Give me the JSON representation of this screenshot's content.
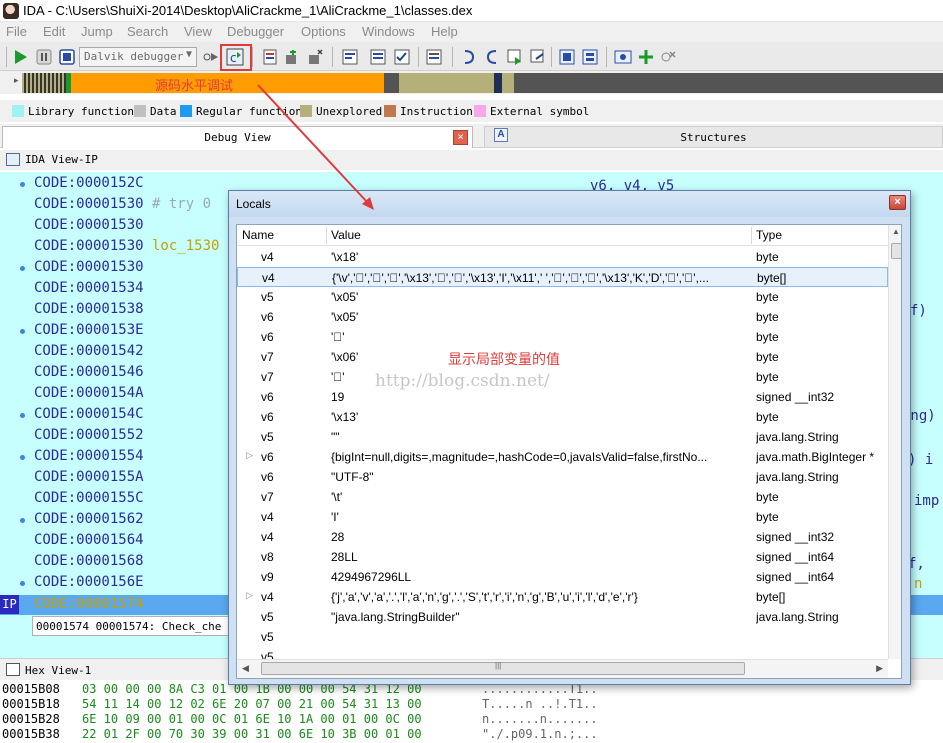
{
  "window": {
    "title": "IDA - C:\\Users\\ShuiXi-2014\\Desktop\\AliCrackme_1\\AliCrackme_1\\classes.dex"
  },
  "menu": [
    "File",
    "Edit",
    "Jump",
    "Search",
    "View",
    "Debugger",
    "Options",
    "Windows",
    "Help"
  ],
  "toolbar": {
    "debugger_select": "Dalvik debugger"
  },
  "legend": [
    {
      "label": "Library function",
      "color": "#9ff2f2"
    },
    {
      "label": "Data",
      "color": "#c0c0c0"
    },
    {
      "label": "Regular function",
      "color": "#1e9af0"
    },
    {
      "label": "Unexplored",
      "color": "#b5b07a"
    },
    {
      "label": "Instruction",
      "color": "#c07850"
    },
    {
      "label": "External symbol",
      "color": "#f7a8ea"
    }
  ],
  "tabs": {
    "debug_view": "Debug View",
    "structures": "Structures",
    "a_glyph": "A",
    "close_glyph": "×"
  },
  "ida_view": {
    "title": "IDA View-IP",
    "lines": [
      {
        "addr": "CODE:0000152C",
        "rest": ""
      },
      {
        "addr": "CODE:00001530",
        "rest": " # try 0"
      },
      {
        "addr": "CODE:00001530",
        "rest": ""
      },
      {
        "addr": "CODE:00001530",
        "rest": " loc_1530"
      },
      {
        "addr": "CODE:00001530",
        "rest": ""
      },
      {
        "addr": "CODE:00001534",
        "rest": ""
      },
      {
        "addr": "CODE:00001538",
        "rest": ""
      },
      {
        "addr": "CODE:0000153E",
        "rest": ""
      },
      {
        "addr": "CODE:00001542",
        "rest": ""
      },
      {
        "addr": "CODE:00001546",
        "rest": ""
      },
      {
        "addr": "CODE:0000154A",
        "rest": ""
      },
      {
        "addr": "CODE:0000154C",
        "rest": ""
      },
      {
        "addr": "CODE:00001552",
        "rest": ""
      },
      {
        "addr": "CODE:00001554",
        "rest": ""
      },
      {
        "addr": "CODE:0000155A",
        "rest": ""
      },
      {
        "addr": "CODE:0000155C",
        "rest": ""
      },
      {
        "addr": "CODE:00001562",
        "rest": ""
      },
      {
        "addr": "CODE:00001564",
        "rest": ""
      },
      {
        "addr": "CODE:00001568",
        "rest": ""
      },
      {
        "addr": "CODE:0000156E",
        "rest": ""
      }
    ],
    "ip_marker": "IP",
    "ip_line": "CODE:00001574",
    "status": "00001574 00001574: Check_che",
    "right_fragments": [
      "v6, v4, v5",
      "f)",
      "ing)",
      ") i",
      "imp",
      "f,",
      "n"
    ]
  },
  "locals": {
    "title": "Locals",
    "close_glyph": "×",
    "columns": {
      "name": "Name",
      "value": "Value",
      "type": "Type"
    },
    "rows": [
      {
        "name": "v4",
        "value": "'\\x18'",
        "type": "byte",
        "expandable": false
      },
      {
        "name": "v4",
        "value": "{'\\v','\u0000','\u0000','\u0000','\\x13','\u0000','\u0000','\\x13','I','\\x11',' ','\u0000','\u0000','\u0000','\\x13','K','D','\u0000','\u0000',...",
        "type": "byte[]",
        "expandable": false,
        "selected": true
      },
      {
        "name": "v5",
        "value": "'\\x05'",
        "type": "byte",
        "expandable": false
      },
      {
        "name": "v6",
        "value": "'\\x05'",
        "type": "byte",
        "expandable": false
      },
      {
        "name": "v6",
        "value": "'\u0000'",
        "type": "byte",
        "expandable": false
      },
      {
        "name": "v7",
        "value": "'\\x06'",
        "type": "byte",
        "expandable": false
      },
      {
        "name": "v7",
        "value": "'\u0000'",
        "type": "byte",
        "expandable": false
      },
      {
        "name": "v6",
        "value": "19",
        "type": "signed __int32",
        "expandable": false
      },
      {
        "name": "v6",
        "value": "'\\x13'",
        "type": "byte",
        "expandable": false
      },
      {
        "name": "v5",
        "value": "\"\"",
        "type": "java.lang.String",
        "expandable": false
      },
      {
        "name": "v6",
        "value": "{bigInt=null,digits=,magnitude=,hashCode=0,javaIsValid=false,firstNo...",
        "type": "java.math.BigInteger *",
        "expandable": true
      },
      {
        "name": "v6",
        "value": "\"UTF-8\"",
        "type": "java.lang.String",
        "expandable": false
      },
      {
        "name": "v7",
        "value": "'\\t'",
        "type": "byte",
        "expandable": false
      },
      {
        "name": "v4",
        "value": "'I'",
        "type": "byte",
        "expandable": false
      },
      {
        "name": "v4",
        "value": "28",
        "type": "signed __int32",
        "expandable": false
      },
      {
        "name": "v8",
        "value": "28LL",
        "type": "signed __int64",
        "expandable": false
      },
      {
        "name": "v9",
        "value": "4294967296LL",
        "type": "signed __int64",
        "expandable": false
      },
      {
        "name": "v4",
        "value": "{'j','a','v','a','.','l','a','n','g','.','S','t','r','i','n','g','B','u','i','l','d','e','r'}",
        "type": "byte[]",
        "expandable": true
      },
      {
        "name": "v5",
        "value": "\"java.lang.StringBuilder\"",
        "type": "java.lang.String",
        "expandable": false
      },
      {
        "name": "v5",
        "value": "",
        "type": "",
        "expandable": false
      },
      {
        "name": "v5",
        "value": "",
        "type": "",
        "expandable": false
      }
    ]
  },
  "annotations": {
    "source_horizontal_debug": "源码水平调试",
    "show_local_values": "显示局部变量的值"
  },
  "watermark": "http://blog.csdn.net/",
  "hex_view": {
    "title": "Hex View-1",
    "rows": [
      {
        "addr": "00015B08",
        "bytes": "03 00 00 00 8A C3 01 00  1B 00 00 00 54 31 12 00",
        "ascii": "............T1.."
      },
      {
        "addr": "00015B18",
        "bytes": "54 11 14 00 12 02 6E 20  07 00 21 00 54 31 13 00",
        "ascii": "T.....n ..!.T1.."
      },
      {
        "addr": "00015B28",
        "bytes": "6E 10 09 00 01 00 0C 01  6E 10 1A 00 01 00 0C 00",
        "ascii": "n.......n......."
      },
      {
        "addr": "00015B38",
        "bytes": "22 01 2F 00 70 30 39 00  31 00 6E 10 3B 00 01 00",
        "ascii": "\"./.p09.1.n.;..."
      }
    ]
  }
}
